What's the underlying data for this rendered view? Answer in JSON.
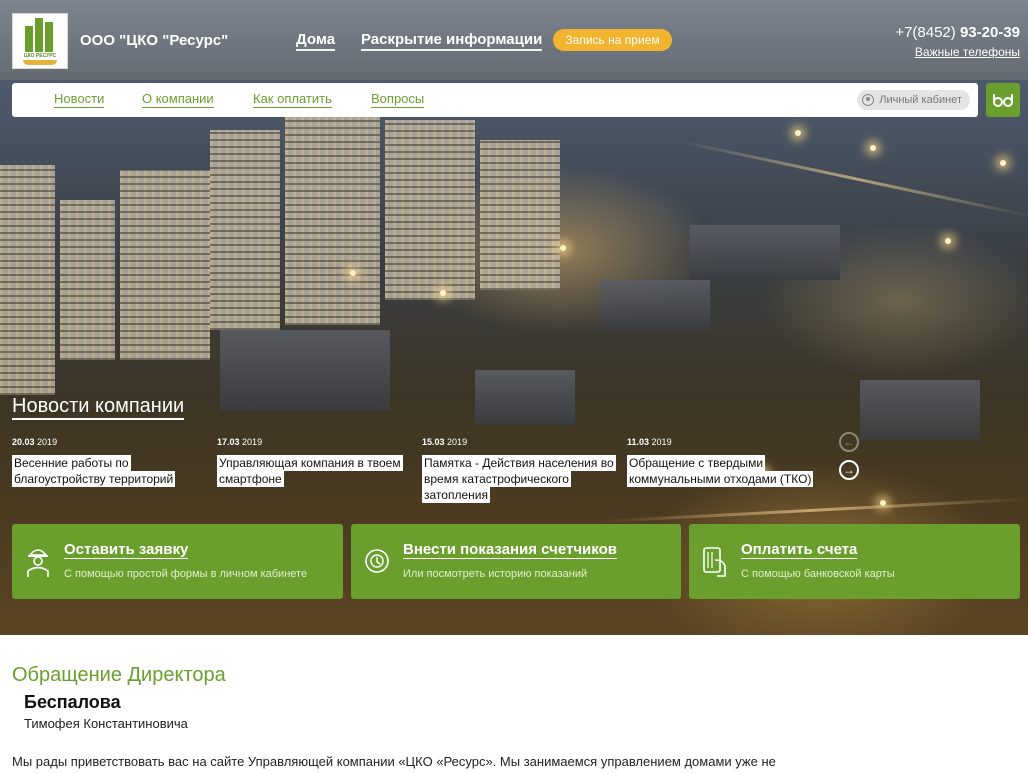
{
  "header": {
    "logo_text": "ЦКО РЕСУРС",
    "company_name": "ООО \"ЦКО \"Ресурс\"",
    "top_links": [
      "Дома",
      "Раскрытие информации"
    ],
    "appointment_button": "Запись на прием",
    "phone_prefix": "+7(8452)",
    "phone_number": "93-20-39",
    "important_phones": "Важные телефоны"
  },
  "nav": {
    "items": [
      "Новости",
      "О компании",
      "Как оплатить",
      "Вопросы"
    ],
    "cabinet": "Личный кабинет",
    "accessibility_icon": "glasses-icon"
  },
  "news": {
    "title": "Новости компании",
    "items": [
      {
        "date": "20.03",
        "year": "2019",
        "text": "Весенние работы по благоустройству территорий"
      },
      {
        "date": "17.03",
        "year": "2019",
        "text": "Управляющая компания в твоем смартфоне"
      },
      {
        "date": "15.03",
        "year": "2019",
        "text": "Памятка - Действия населения во время катастрофического затопления"
      },
      {
        "date": "11.03",
        "year": "2019",
        "text": "Обращение с твердыми коммунальными отходами (ТКО)"
      }
    ]
  },
  "actions": [
    {
      "title": "Оставить заявку",
      "subtitle": "С помощью простой формы в личном кабинете",
      "icon": "worker-icon"
    },
    {
      "title": "Внести показания счетчиков",
      "subtitle": "Или посмотреть историю показаний",
      "icon": "meter-icon"
    },
    {
      "title": "Оплатить счета",
      "subtitle": "С помощью банковской карты",
      "icon": "card-icon"
    }
  ],
  "director": {
    "title": "Обращение Директора",
    "last_name": "Беспалова",
    "first_name": "Тимофея Константиновича",
    "intro": "Мы рады приветствовать вас на сайте Управляющей компании «ЦКО «Ресурс». Мы занимаемся управлением домами уже не"
  },
  "colors": {
    "accent": "#6a9f2e",
    "button_yellow": "#f2b32f"
  }
}
